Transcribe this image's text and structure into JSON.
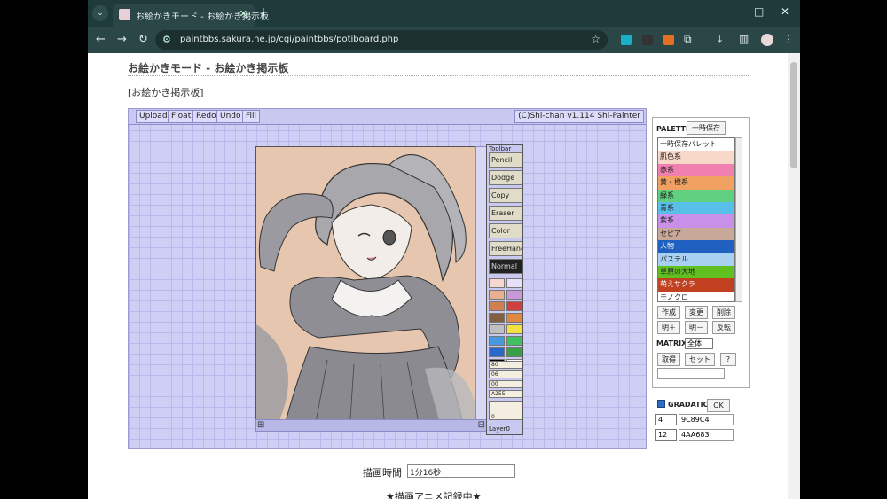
{
  "browser": {
    "tab_title": "お絵かきモード - お絵かき掲示板",
    "url": "paintbbs.sakura.ne.jp/cgi/paintbbs/potiboard.php"
  },
  "page": {
    "title": "お絵かきモード - お絵かき掲示板",
    "board_link": "お絵かき掲示板",
    "draw_time_label": "描画時間",
    "draw_time_value": "1分16秒",
    "anime_label": "★描画アニメ記録中★"
  },
  "applet": {
    "buttons": [
      "Upload",
      "Float",
      "Redo",
      "Undo",
      "Fill"
    ],
    "credit": "(C)Shi-chan v1.114 Shi-Painter"
  },
  "tools": {
    "title": "Toolbar",
    "items": [
      "Pencil",
      "Dodge",
      "Copy",
      "Eraser",
      "Color",
      "FreeHand",
      "Normal"
    ],
    "swatches": [
      "#f4d8d0",
      "#e8e0f8",
      "#e8b090",
      "#c898d8",
      "#d08050",
      "#d04040",
      "#806040",
      "#e08840",
      "#c0c0c0",
      "#f0e040",
      "#4898e0",
      "#40c060",
      "#2868c8",
      "#38a048",
      "#000000",
      "#ffffff"
    ],
    "sliders": [
      "80",
      "06",
      "00",
      "A255"
    ],
    "size": "0",
    "layer": "Layer0"
  },
  "palette": {
    "title": "PALETTE",
    "save_btn": "一時保存",
    "items": [
      {
        "label": "一時保存パレット",
        "color": "#ffffff"
      },
      {
        "label": "肌色系",
        "color": "#f8d8c8"
      },
      {
        "label": "赤系",
        "color": "#f080b0"
      },
      {
        "label": "黄・橙系",
        "color": "#f0a060"
      },
      {
        "label": "緑系",
        "color": "#60d080"
      },
      {
        "label": "青系",
        "color": "#58c0e8"
      },
      {
        "label": "紫系",
        "color": "#c890e8"
      },
      {
        "label": "セピア",
        "color": "#c8a898"
      },
      {
        "label": "人物",
        "color": "#2060c0"
      },
      {
        "label": "パステル",
        "color": "#a8d0f0"
      },
      {
        "label": "草原の大地",
        "color": "#60c020"
      },
      {
        "label": "萌えサクラ",
        "color": "#c04020"
      },
      {
        "label": "モノクロ",
        "color": "#ffffff"
      }
    ],
    "btn_create": "作成",
    "btn_change": "変更",
    "btn_delete": "削除",
    "btn_light": "明＋",
    "btn_dark": "明－",
    "btn_invert": "反転",
    "matrix_label": "MATRIX",
    "matrix_value": "全体",
    "btn_get": "取得",
    "btn_set": "セット",
    "btn_help": "?"
  },
  "gradation": {
    "label": "GRADATION",
    "ok": "OK",
    "row1_num": "4",
    "row1_hex": "9C89C4",
    "row2_num": "12",
    "row2_hex": "4AA683"
  }
}
